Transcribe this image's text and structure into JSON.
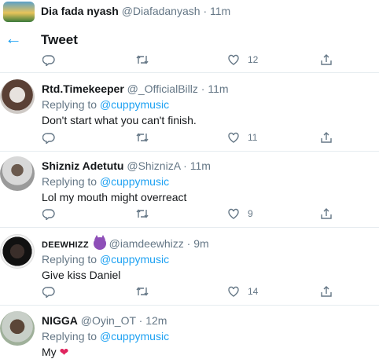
{
  "top_tweet": {
    "display_name": "Dia fada nyash",
    "handle": "@Diafadanyash",
    "time": "11m",
    "like_count": "12"
  },
  "header": {
    "title": "Tweet"
  },
  "replying_label": "Replying to",
  "replies": [
    {
      "display_name": "Rtd.Timekeeper",
      "handle": "@_OfficialBillz",
      "time": "11m",
      "replying_to": "@cuppymusic",
      "text": "Don't start what you can't finish.",
      "like_count": "11"
    },
    {
      "display_name": "Shizniz Adetutu",
      "handle": "@ShiznizA",
      "time": "11m",
      "replying_to": "@cuppymusic",
      "text": "Lol my mouth might overreact",
      "like_count": "9"
    },
    {
      "display_name": "DEEWHIZZ",
      "handle": "@iamdeewhizz",
      "time": "9m",
      "replying_to": "@cuppymusic",
      "text": "Give kiss Daniel",
      "like_count": "14",
      "emoji": "smiling-devil-emoji"
    },
    {
      "display_name": "NIGGA",
      "handle": "@Oyin_OT",
      "time": "12m",
      "replying_to": "@cuppymusic",
      "text": "My",
      "emoji": "red-heart"
    }
  ],
  "separator": "·",
  "colors": {
    "accent": "#1da1f2",
    "muted": "#657786",
    "text": "#14171a",
    "heart": "#e0245e",
    "divider": "#e6ecf0"
  }
}
